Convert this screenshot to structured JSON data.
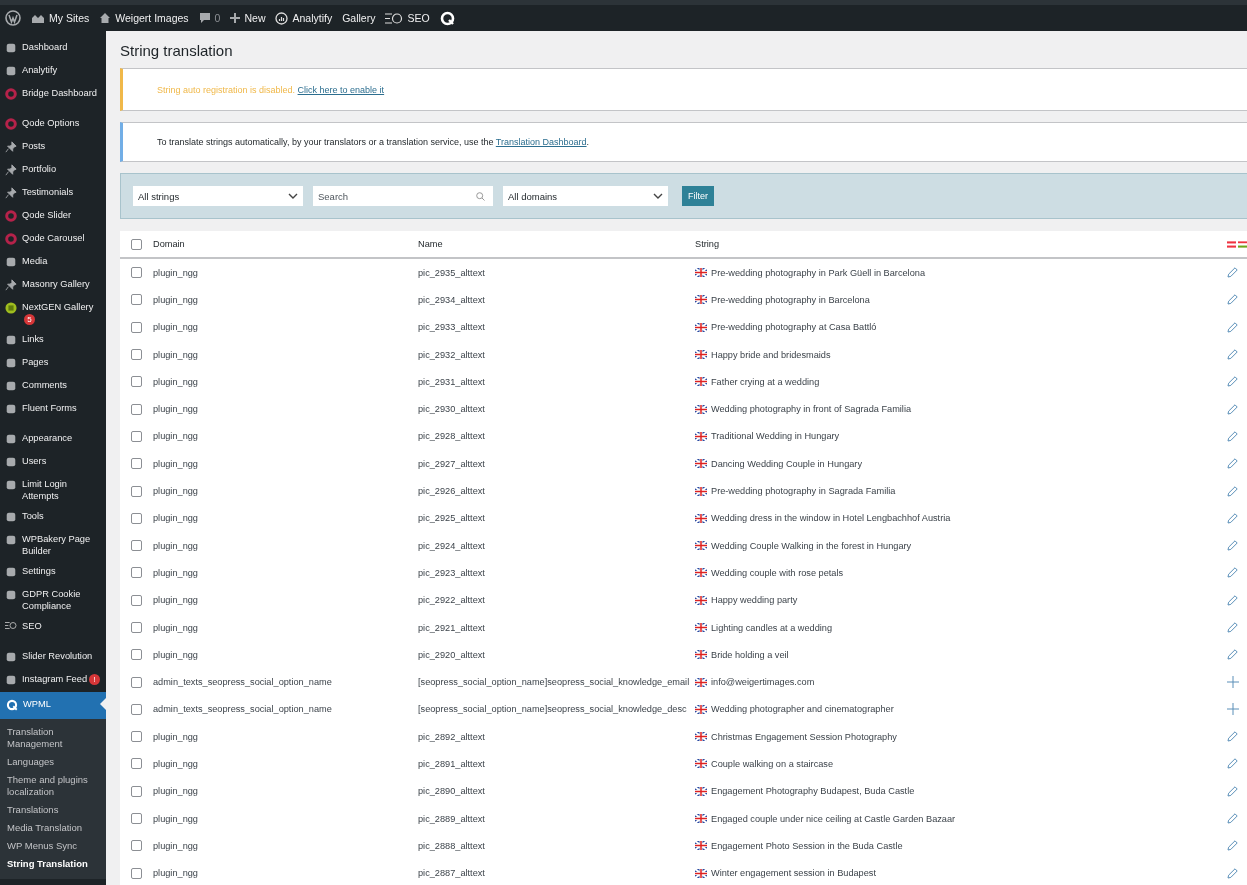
{
  "admin_bar": {
    "items": [
      {
        "kind": "wp"
      },
      {
        "kind": "sites",
        "label": "My Sites"
      },
      {
        "kind": "home",
        "label": "Weigert Images"
      },
      {
        "kind": "comments",
        "label": "0"
      },
      {
        "kind": "new",
        "label": "New"
      },
      {
        "kind": "analytify",
        "label": "Analytify"
      },
      {
        "kind": "text",
        "label": "Gallery"
      },
      {
        "kind": "seo",
        "label": "SEO"
      },
      {
        "kind": "wpml"
      }
    ]
  },
  "sidebar": {
    "items": [
      {
        "label": "Dashboard",
        "selected": false
      },
      {
        "label": "Analytify",
        "selected": false
      },
      {
        "label": "Bridge Dashboard",
        "selected": false
      },
      {
        "label": "Qode Options",
        "selected": false
      },
      {
        "label": "Posts",
        "selected": false
      },
      {
        "label": "Portfolio",
        "selected": false
      },
      {
        "label": "Testimonials",
        "selected": false
      },
      {
        "label": "Qode Slider",
        "selected": false
      },
      {
        "label": "Qode Carousel",
        "selected": false
      },
      {
        "label": "Media",
        "selected": false
      },
      {
        "label": "Masonry Gallery",
        "selected": false
      },
      {
        "label": "NextGEN Gallery",
        "selected": false,
        "badge": "5"
      },
      {
        "label": "Links",
        "selected": false
      },
      {
        "label": "Pages",
        "selected": false
      },
      {
        "label": "Comments",
        "selected": false
      },
      {
        "label": "Fluent Forms",
        "selected": false
      },
      {
        "label": "Appearance",
        "selected": false
      },
      {
        "label": "Users",
        "selected": false
      },
      {
        "label": "Limit Login Attempts",
        "selected": false
      },
      {
        "label": "Tools",
        "selected": false
      },
      {
        "label": "WPBakery Page Builder",
        "selected": false
      },
      {
        "label": "Settings",
        "selected": false
      },
      {
        "label": "GDPR Cookie Compliance",
        "selected": false
      },
      {
        "label": "SEO",
        "selected": false
      },
      {
        "label": "Slider Revolution",
        "selected": false
      },
      {
        "label": "Instagram Feed",
        "selected": false,
        "badge": "!"
      },
      {
        "label": "WPML",
        "selected": true
      }
    ],
    "submenu": [
      {
        "label": "Translation Management",
        "selected": false
      },
      {
        "label": "Languages",
        "selected": false
      },
      {
        "label": "Theme and plugins localization",
        "selected": false
      },
      {
        "label": "Translations",
        "selected": false
      },
      {
        "label": "Media Translation",
        "selected": false
      },
      {
        "label": "WP Menus Sync",
        "selected": false
      },
      {
        "label": "String Translation",
        "selected": true
      }
    ]
  },
  "page_title": "String translation",
  "notice_warning": {
    "text": "String auto registration is disabled.",
    "link": "Click here to enable it"
  },
  "notice_info": {
    "text": "To translate strings automatically, by your translators or a translation service, use the",
    "link": "Translation Dashboard",
    "after": "."
  },
  "filters": {
    "strings_select": "All strings",
    "search": {
      "placeholder": "Search"
    },
    "domains_select": "All domains",
    "button": "Filter"
  },
  "table": {
    "columns": [
      "Domain",
      "Name",
      "String"
    ],
    "select_all_checked": false,
    "rows": [
      {
        "domain": "plugin_ngg",
        "name": "pic_2935_alttext",
        "string": "Pre-wedding photography in Park Güell in Barcelona",
        "kind": "edit",
        "checked": false
      },
      {
        "domain": "plugin_ngg",
        "name": "pic_2934_alttext",
        "string": "Pre-wedding photography in Barcelona",
        "kind": "edit",
        "checked": false
      },
      {
        "domain": "plugin_ngg",
        "name": "pic_2933_alttext",
        "string": "Pre-wedding photography at Casa Battló",
        "kind": "edit",
        "checked": false
      },
      {
        "domain": "plugin_ngg",
        "name": "pic_2932_alttext",
        "string": "Happy bride and bridesmaids",
        "kind": "edit",
        "checked": false
      },
      {
        "domain": "plugin_ngg",
        "name": "pic_2931_alttext",
        "string": "Father crying at a wedding",
        "kind": "edit",
        "checked": false
      },
      {
        "domain": "plugin_ngg",
        "name": "pic_2930_alttext",
        "string": "Wedding photography in front of Sagrada Familia",
        "kind": "edit",
        "checked": false
      },
      {
        "domain": "plugin_ngg",
        "name": "pic_2928_alttext",
        "string": "Traditional Wedding in Hungary",
        "kind": "edit",
        "checked": false
      },
      {
        "domain": "plugin_ngg",
        "name": "pic_2927_alttext",
        "string": "Dancing Wedding Couple in Hungary",
        "kind": "edit",
        "checked": false
      },
      {
        "domain": "plugin_ngg",
        "name": "pic_2926_alttext",
        "string": "Pre-wedding photography in Sagrada Familia",
        "kind": "edit",
        "checked": false
      },
      {
        "domain": "plugin_ngg",
        "name": "pic_2925_alttext",
        "string": "Wedding dress in the window in Hotel Lengbachhof Austria",
        "kind": "edit",
        "checked": false
      },
      {
        "domain": "plugin_ngg",
        "name": "pic_2924_alttext",
        "string": "Wedding Couple Walking in the forest in Hungary",
        "kind": "edit",
        "checked": false
      },
      {
        "domain": "plugin_ngg",
        "name": "pic_2923_alttext",
        "string": "Wedding couple with rose petals",
        "kind": "edit",
        "checked": false
      },
      {
        "domain": "plugin_ngg",
        "name": "pic_2922_alttext",
        "string": "Happy wedding party",
        "kind": "edit",
        "checked": false
      },
      {
        "domain": "plugin_ngg",
        "name": "pic_2921_alttext",
        "string": "Lighting candles at a wedding",
        "kind": "edit",
        "checked": false
      },
      {
        "domain": "plugin_ngg",
        "name": "pic_2920_alttext",
        "string": "Bride holding a veil",
        "kind": "edit",
        "checked": false
      },
      {
        "domain": "admin_texts_seopress_social_option_name",
        "name": "[seopress_social_option_name]seopress_social_knowledge_email",
        "string": "info@weigertimages.com",
        "kind": "add",
        "checked": false
      },
      {
        "domain": "admin_texts_seopress_social_option_name",
        "name": "[seopress_social_option_name]seopress_social_knowledge_desc",
        "string": "Wedding photographer and cinematographer",
        "kind": "add",
        "checked": false
      },
      {
        "domain": "plugin_ngg",
        "name": "pic_2892_alttext",
        "string": "Christmas Engagement Session Photography",
        "kind": "edit",
        "checked": false
      },
      {
        "domain": "plugin_ngg",
        "name": "pic_2891_alttext",
        "string": "Couple walking on a staircase",
        "kind": "edit",
        "checked": false
      },
      {
        "domain": "plugin_ngg",
        "name": "pic_2890_alttext",
        "string": "Engagement Photography Budapest, Buda Castle",
        "kind": "edit",
        "checked": false
      },
      {
        "domain": "plugin_ngg",
        "name": "pic_2889_alttext",
        "string": "Engaged couple under nice ceiling at Castle Garden Bazaar",
        "kind": "edit",
        "checked": false
      },
      {
        "domain": "plugin_ngg",
        "name": "pic_2888_alttext",
        "string": "Engagement Photo Session in the Buda Castle",
        "kind": "edit",
        "checked": false
      },
      {
        "domain": "plugin_ngg",
        "name": "pic_2887_alttext",
        "string": "Winter engagement session in Budapest",
        "kind": "edit",
        "checked": false
      }
    ]
  }
}
